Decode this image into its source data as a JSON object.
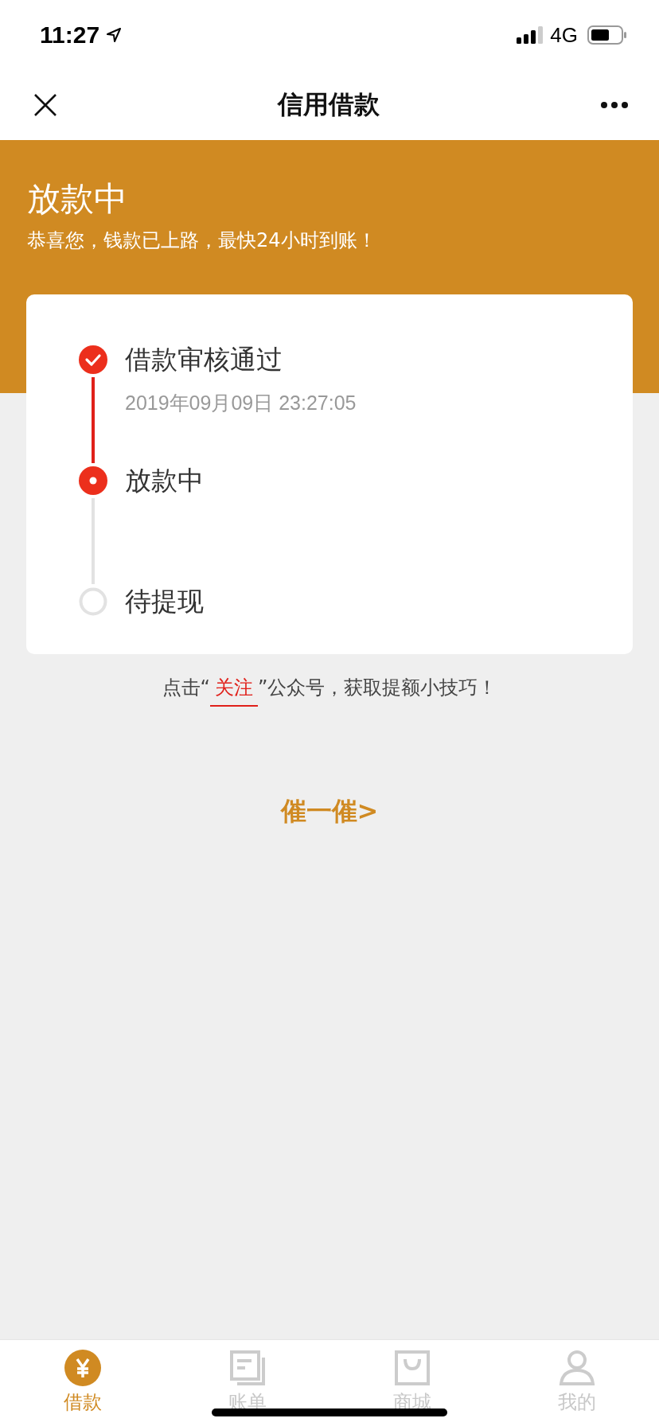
{
  "status_bar": {
    "time": "11:27",
    "network": "4G"
  },
  "nav": {
    "title": "信用借款"
  },
  "header": {
    "title": "放款中",
    "subtitle": "恭喜您，钱款已上路，最快24小时到账！"
  },
  "steps": [
    {
      "label": "借款审核通过",
      "time": "2019年09月09日 23:27:05",
      "kind": "done"
    },
    {
      "label": "放款中",
      "kind": "current"
    },
    {
      "label": "待提现",
      "kind": "pending"
    }
  ],
  "hint": {
    "before": "点击“",
    "link": "关注",
    "after": "”公众号，获取提额小技巧！"
  },
  "action": "催一催>",
  "tabs": [
    {
      "label": "借款",
      "kind": "loan",
      "selected": true
    },
    {
      "label": "账单",
      "kind": "bill",
      "selected": false
    },
    {
      "label": "商城",
      "kind": "shop",
      "selected": false
    },
    {
      "label": "我的",
      "kind": "me",
      "selected": false
    }
  ]
}
